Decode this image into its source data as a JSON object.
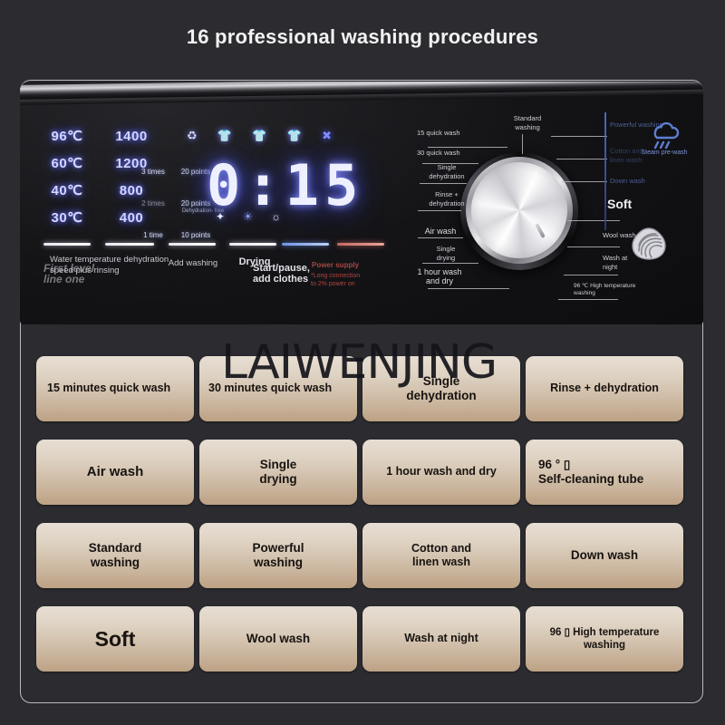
{
  "page": {
    "title": "16 professional washing procedures",
    "watermark": "LAIWENJING"
  },
  "panel": {
    "temperatures": [
      "96℃",
      "60℃",
      "40℃",
      "30℃"
    ],
    "spin_speeds": [
      "1400",
      "1200",
      "800",
      "400"
    ],
    "rinse_times": [
      "3 times",
      "2 times",
      "1 time"
    ],
    "points": [
      "20 points",
      "20 points",
      "10 points"
    ],
    "micro_label": "Dehydration- free",
    "display": {
      "time": "0:15",
      "top_icons": [
        "recycle-icon",
        "shirt-icon",
        "shirt-icon",
        "shirt-icon",
        "no-dry-icon"
      ],
      "bottom_icons": [
        "spark-icon",
        "sun-icon",
        "sun-bright-icon"
      ]
    },
    "labels": {
      "water_temp": "Water temperature dehydration\nspeed plus rinsing",
      "first_level": "First level\nline one",
      "add_washing": "Add washing",
      "drying": "Drying",
      "start_pause": "Start/pause,\nadd clothes",
      "power_note": "*Long connection\nto 2% power on",
      "power_badge": "Power supply"
    },
    "dial_labels_left": [
      "15 quick wash",
      "30 quick wash",
      "Single\ndehydration",
      "Rinse +\ndehydration",
      "Air wash",
      "Single\ndrying",
      "1 hour wash\nand dry"
    ],
    "dial_label_top": "Standard\nwashing",
    "dial_labels_right": [
      "Powerful washing",
      "Cotton and\nlinen wash",
      "Down wash",
      "Soft",
      "Wool wash",
      "Wash at\nnight",
      "96 ℃ High temperature\nwashing"
    ],
    "steam_prewash": "Steam pre-wash",
    "icons": {
      "steam": "steam-cloud-icon",
      "wool": "wool-swirl-icon"
    }
  },
  "tiles": [
    {
      "label": "15 minutes quick wash",
      "size": "fs12"
    },
    {
      "label": "30 minutes quick wash",
      "size": "fs12"
    },
    {
      "label": "Single\ndehydration",
      "size": "fs13"
    },
    {
      "label": "Rinse + dehydration",
      "size": "fs12"
    },
    {
      "label": "Air wash",
      "size": "fs15"
    },
    {
      "label": "Single\ndrying",
      "size": "fs13"
    },
    {
      "label": "1 hour wash and dry",
      "size": "fs12"
    },
    {
      "label": "96 ° ▯\nSelf-cleaning tube",
      "size": "fs13"
    },
    {
      "label": "Standard\nwashing",
      "size": "fs13"
    },
    {
      "label": "Powerful\nwashing",
      "size": "fs13"
    },
    {
      "label": "Cotton and\nlinen wash",
      "size": "fs12"
    },
    {
      "label": "Down wash",
      "size": "fs13"
    },
    {
      "label": "Soft",
      "size": "fs22"
    },
    {
      "label": "Wool wash",
      "size": "fs13"
    },
    {
      "label": "Wash at night",
      "size": "fs12"
    },
    {
      "label": "96 ▯ High temperature\nwashing",
      "size": "fs11"
    }
  ],
  "colors": {
    "background": "#2b2b30",
    "tile_top": "#e7ded3",
    "tile_bottom": "#bda284",
    "led_blue": "#d2d6ff",
    "accent_blue": "#5a78d8",
    "warning_red": "#b4453f"
  }
}
